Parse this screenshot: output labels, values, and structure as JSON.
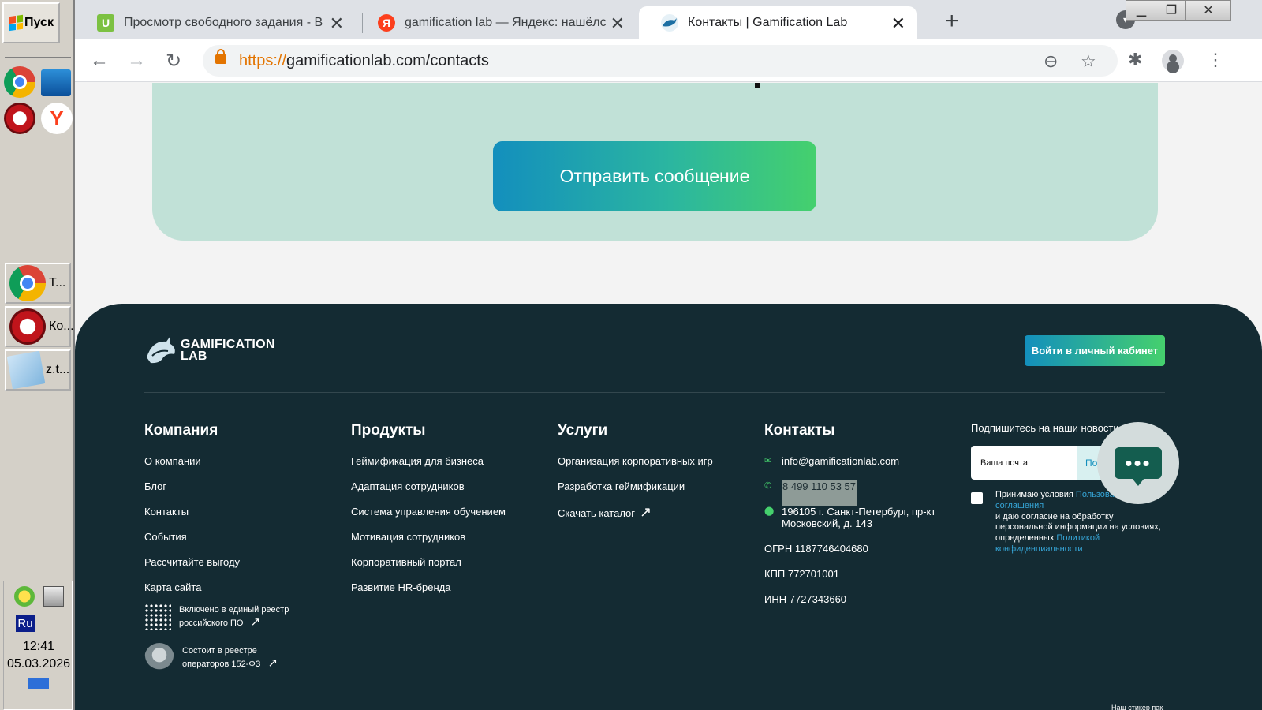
{
  "taskbar": {
    "start_label": "Пуск",
    "tasks": [
      {
        "label": "Т...",
        "icon": "chrome-icon"
      },
      {
        "label": "Ко...",
        "icon": "opera-icon"
      },
      {
        "label": "z.t...",
        "icon": "notepad-icon"
      }
    ],
    "lang": "Ru",
    "time": "12:41",
    "date": "05.03.2026"
  },
  "browser": {
    "tabs": [
      {
        "title": "Просмотр свободного задания - В",
        "favicon": "U",
        "favicon_color": "#7cc142"
      },
      {
        "title": "gamification lab — Яндекс: нашёлс",
        "favicon": "Я",
        "favicon_color": "#fc3f1d"
      },
      {
        "title": "Контакты | Gamification Lab",
        "favicon": "shark",
        "favicon_color": "#1d6fa3"
      }
    ],
    "url_proto": "https://",
    "url_rest": "gamificationlab.com/contacts"
  },
  "page": {
    "send_button": "Отправить сообщение",
    "footer": {
      "logo_line1": "GAMIFICATION",
      "logo_line2": "LAB",
      "cabinet_button": "Войти в личный кабинет",
      "company": {
        "title": "Компания",
        "links": [
          "О компании",
          "Блог",
          "Контакты",
          "События",
          "Рассчитайте выгоду",
          "Карта сайта"
        ]
      },
      "registry1": {
        "line1": "Включено в единый реестр",
        "line2": "российского ПО"
      },
      "registry2": {
        "line1": "Состоит в реестре",
        "line2": "операторов 152-ФЗ"
      },
      "products": {
        "title": "Продукты",
        "links": [
          "Геймификация для бизнеса",
          "Адаптация сотрудников",
          "Система управления обучением",
          "Мотивация сотрудников",
          "Корпоративный портал",
          "Развитие HR-бренда"
        ]
      },
      "services": {
        "title": "Услуги",
        "links": [
          "Организация корпоративных игр",
          "Разработка геймификации",
          "Скачать каталог"
        ]
      },
      "contacts": {
        "title": "Контакты",
        "email": "info@gamificationlab.com",
        "phone": "8 499 110 53 57",
        "address_line1": "196105 г. Санкт-Петербург, пр-кт",
        "address_line2": "Московский, д. 143",
        "ogrn": "ОГРН 1187746404680",
        "kpp": "КПП 772701001",
        "inn": "ИНН 7727343660"
      },
      "subscribe": {
        "label": "Подпишитесь на наши новости",
        "placeholder": "Ваша почта",
        "button": "По",
        "agree_prefix": "Принимаю условия",
        "agree_link1_a": "Пользоват",
        "agree_link1_b": "соглашения",
        "agree_mid": "и даю согласие на обработку персональной информации на условиях, определенных",
        "agree_link2_a": "Политикой",
        "agree_link2_b": "конфиденциальности"
      },
      "sticker_text": "Наш стикер пак"
    }
  }
}
